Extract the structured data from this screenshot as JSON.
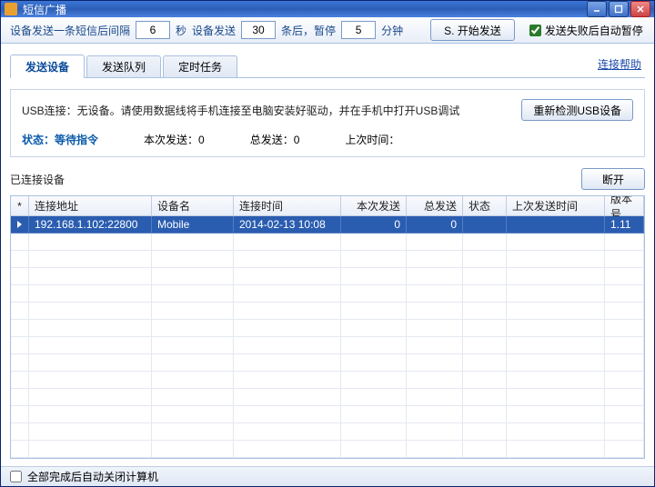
{
  "titlebar": {
    "title": "短信广播"
  },
  "toolbar": {
    "label1": "设备发送一条短信后间隔",
    "interval_val": "6",
    "seconds": "秒",
    "label2": "设备发送",
    "batch_val": "30",
    "label3": "条后，暂停",
    "pause_val": "5",
    "minutes": "分钟",
    "start_btn": "S. 开始发送",
    "fail_pause_label": "发送失败后自动暂停"
  },
  "tabs": {
    "t1": "发送设备",
    "t2": "发送队列",
    "t3": "定时任务",
    "help_link": "连接帮助"
  },
  "info": {
    "usb_label": "USB连接：无设备。请使用数据线将手机连接至电脑安装好驱动，并在手机中打开USB调试",
    "rescan_btn": "重新检测USB设备",
    "status_label": "状态：",
    "status_val": "等待指令",
    "this_send": "本次发送：0",
    "total_send": "总发送：0",
    "last_time": "上次时间："
  },
  "list": {
    "title": "已连接设备",
    "disconnect_btn": "断开",
    "headers": {
      "star": "*",
      "addr": "连接地址",
      "name": "设备名",
      "conn_time": "连接时间",
      "this_send": "本次发送",
      "total_send": "总发送",
      "status": "状态",
      "last_send_time": "上次发送时间",
      "version": "版本号"
    },
    "rows": [
      {
        "addr": "192.168.1.102:22800",
        "name": "Mobile",
        "conn_time": "2014-02-13 10:08",
        "this_send": "0",
        "total_send": "0",
        "status": "",
        "last_send_time": "",
        "version": "1.11",
        "selected": true
      }
    ]
  },
  "footer": {
    "shutdown_label": "全部完成后自动关闭计算机"
  }
}
